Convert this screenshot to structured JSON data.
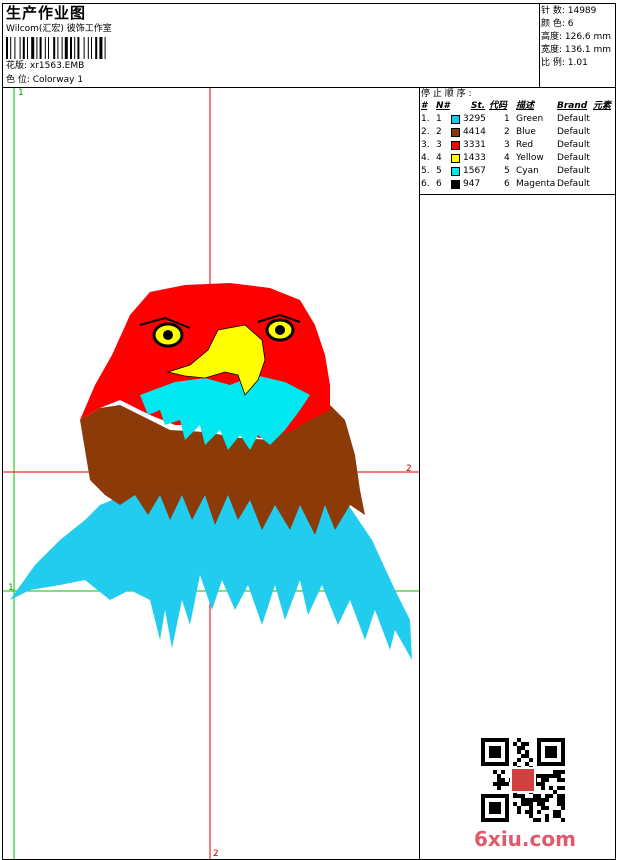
{
  "header": {
    "title": "生产作业图",
    "software": "Wilcom(汇宏) 彼饰工作室",
    "design_label": "花版: xr1563.EMB",
    "colorway_label": "色 位:  Colorway 1"
  },
  "stats": {
    "stitches": "针 数: 14989",
    "colors": "颜 色: 6",
    "height": "高度: 126.6 mm",
    "width": "宽度: 136.1 mm",
    "scale": "比 例: 1.01"
  },
  "stop_sequence": {
    "title": "停 止 顺 序 :",
    "headers": [
      "#",
      "N#",
      "St.",
      "代码",
      "描述",
      "Brand",
      "元素"
    ],
    "rows": [
      {
        "idx": "1.",
        "n": "1",
        "st": "3295",
        "code": "1",
        "desc": "Green",
        "brand": "Default",
        "color": "#1ec8e8"
      },
      {
        "idx": "2.",
        "n": "2",
        "st": "4414",
        "code": "2",
        "desc": "Blue",
        "brand": "Default",
        "color": "#8a3a0a"
      },
      {
        "idx": "3.",
        "n": "3",
        "st": "3331",
        "code": "3",
        "desc": "Red",
        "brand": "Default",
        "color": "#ff0000"
      },
      {
        "idx": "4.",
        "n": "4",
        "st": "1433",
        "code": "4",
        "desc": "Yellow",
        "brand": "Default",
        "color": "#ffff00"
      },
      {
        "idx": "5.",
        "n": "5",
        "st": "1567",
        "code": "5",
        "desc": "Cyan",
        "brand": "Default",
        "color": "#00e8f0"
      },
      {
        "idx": "6.",
        "n": "6",
        "st": "947",
        "code": "6",
        "desc": "Magenta",
        "brand": "Default",
        "color": "#000000"
      }
    ]
  },
  "canvas": {
    "marker_1": "1",
    "marker_2": "2",
    "guide_color_green": "#00c000",
    "guide_color_red": "#e00000"
  },
  "watermark": "6xiu.com"
}
